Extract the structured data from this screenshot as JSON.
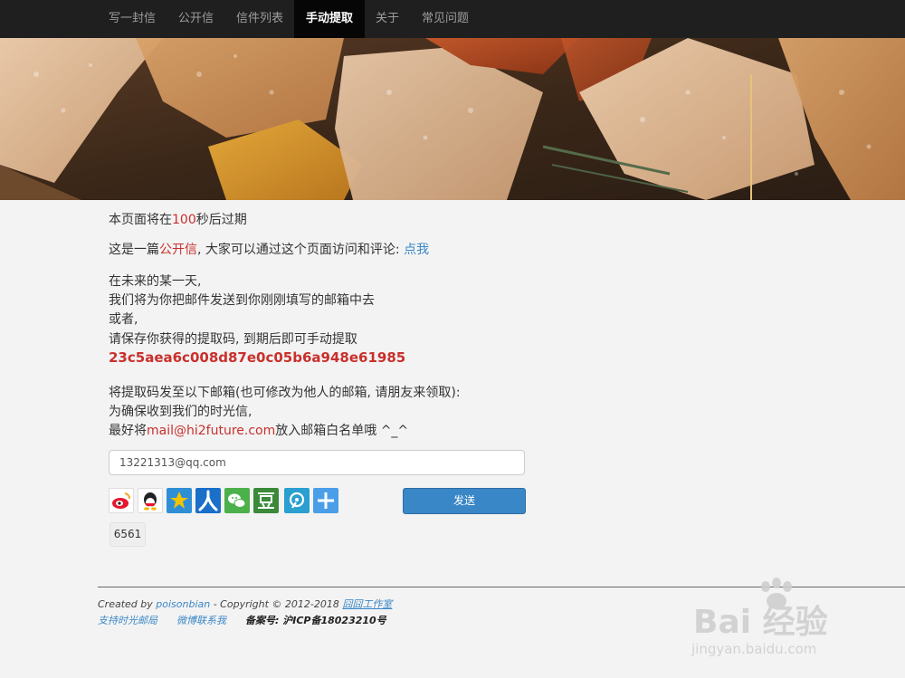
{
  "nav": {
    "items": [
      {
        "label": "写一封信"
      },
      {
        "label": "公开信"
      },
      {
        "label": "信件列表"
      },
      {
        "label": "手动提取",
        "active": true
      },
      {
        "label": "关于"
      },
      {
        "label": "常见问题"
      }
    ]
  },
  "notice": {
    "prefix": "本页面将在",
    "seconds": "100",
    "suffix": "秒后过期"
  },
  "public_line": {
    "prefix": "这是一篇",
    "highlight": "公开信",
    "middle": ", 大家可以通过这个页面访问和评论: ",
    "link": "点我"
  },
  "message": {
    "line1": "在未来的某一天,",
    "line2": "我们将为你把邮件发送到你刚刚填写的邮箱中去",
    "line3": "或者,",
    "line4": "请保存你获得的提取码, 到期后即可手动提取",
    "code": "23c5aea6c008d87e0c05b6a948e61985"
  },
  "send_section": {
    "line1": "将提取码发至以下邮箱(也可修改为他人的邮箱, 请朋友来领取):",
    "line2": "为确保收到我们的时光信,",
    "line3_prefix": "最好将",
    "email_highlight": "mail@hi2future.com",
    "line3_suffix": "放入邮箱白名单哦 ^_^"
  },
  "email_input": {
    "value": "13221313@qq.com"
  },
  "share_icons": [
    "weibo-icon",
    "qq-icon",
    "qzone-icon",
    "renren-icon",
    "wechat-icon",
    "douban-icon",
    "tencent-weibo-icon",
    "more-plus-icon"
  ],
  "send_button": {
    "label": "发送"
  },
  "captcha": {
    "value": "6561"
  },
  "footer": {
    "created_by": "Created by ",
    "author": "poisonbian",
    "copyright": " - Copyright © 2012-2018 ",
    "studio": "囧囧工作室",
    "support": "支持时光邮局",
    "contact": "微博联系我",
    "icp": "备案号: 沪ICP备18023210号"
  },
  "watermark": {
    "brand": "Bai 经验",
    "url": "jingyan.baidu.com"
  },
  "colors": {
    "navbar": "#1f1f1f",
    "accent_red": "#c9302c",
    "link_blue": "#3a87c7",
    "button_blue": "#3a87c7"
  }
}
